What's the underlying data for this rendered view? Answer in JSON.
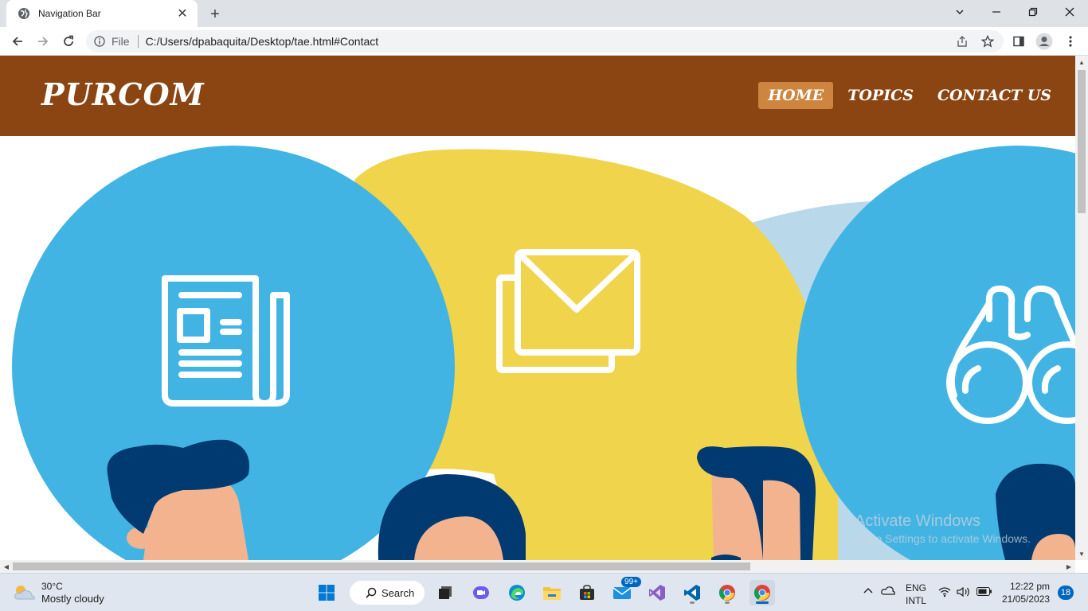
{
  "browser": {
    "tab_title": "Navigation Bar",
    "new_tab_label": "+",
    "protocol_label": "File",
    "url": "C:/Users/dpabaquita/Desktop/tae.html#Contact"
  },
  "site": {
    "brand": "PURCOM",
    "nav": [
      {
        "label": "HOME",
        "active": true
      },
      {
        "label": "TOPICS",
        "active": false
      },
      {
        "label": "CONTACT US",
        "active": false
      }
    ],
    "colors": {
      "nav_bg": "#8b4513",
      "nav_active": "#cd853f",
      "blue": "#42b4e4",
      "yellow": "#f0d44c",
      "light_blue": "#b9d8ea",
      "navy": "#003a70",
      "skin": "#f3b38e"
    }
  },
  "watermark": {
    "line1": "Activate Windows",
    "line2": "Go to Settings to activate Windows."
  },
  "taskbar": {
    "weather_temp": "30°C",
    "weather_condition": "Mostly cloudy",
    "search_label": "Search",
    "mail_badge": "99+",
    "language": "ENG",
    "layout": "INTL",
    "time": "12:22 pm",
    "date": "21/05/2023",
    "notifications": "18"
  }
}
